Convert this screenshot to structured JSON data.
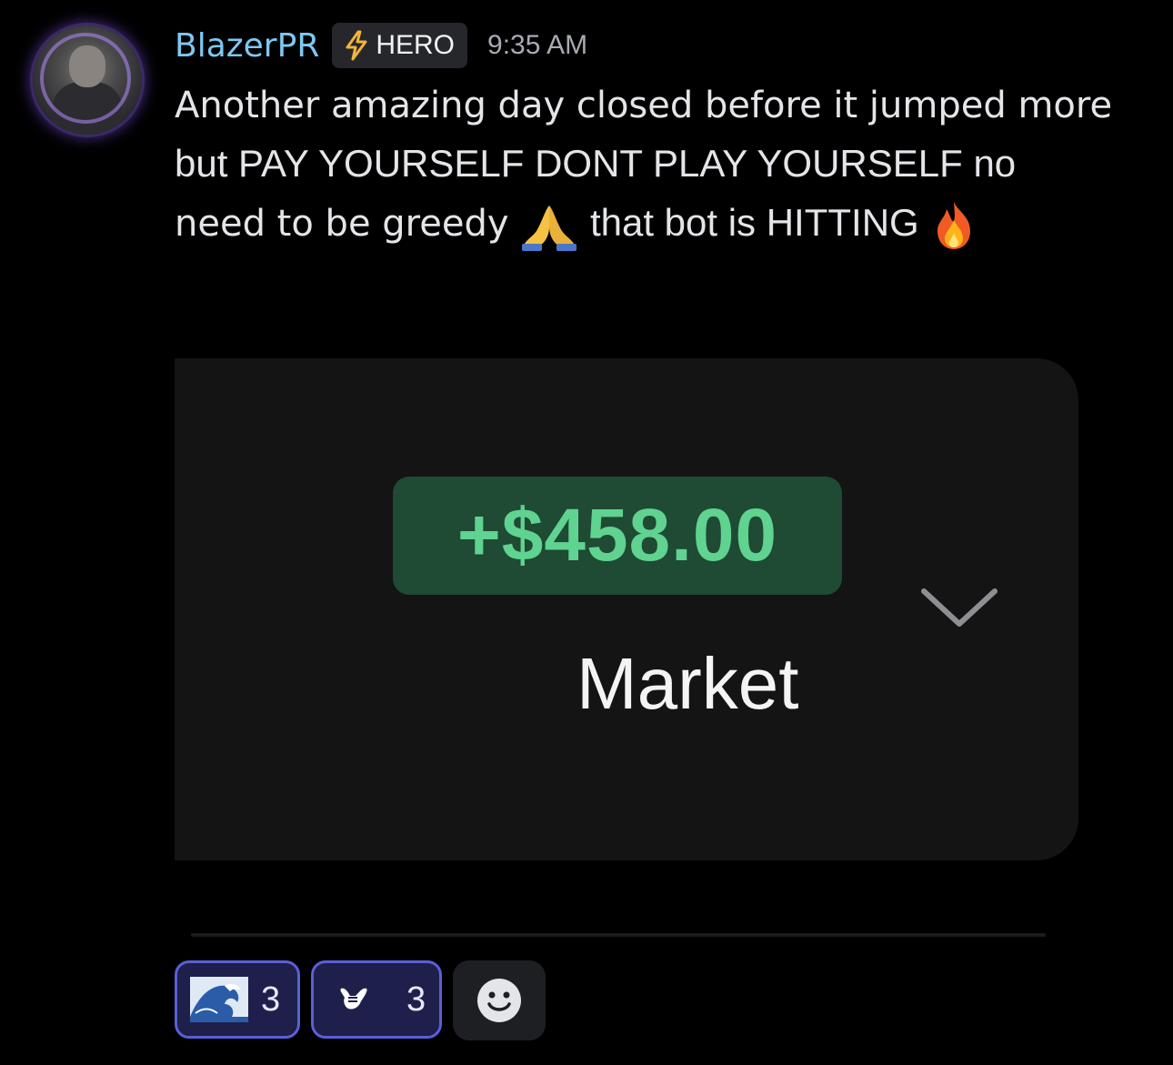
{
  "author": {
    "username": "BlazerPR",
    "badge": {
      "icon": "lightning-bolt-icon",
      "label": "HERO"
    },
    "timestamp": "9:35 AM"
  },
  "message": {
    "line1": "Another amazing day closed before it jumped more",
    "line2": "but PAY YOURSELF DONT PLAY YOURSELF no",
    "line3_a": "need to be greedy",
    "line3_b": "that bot is HITTING",
    "emojis": [
      "folded-hands-emoji",
      "fire-emoji"
    ]
  },
  "attachment": {
    "pnl": "+$458.00",
    "label": "Market",
    "icon": "chevron-down-icon"
  },
  "reactions": [
    {
      "emoji": "wave-emoji",
      "count": "3",
      "active": true
    },
    {
      "emoji": "shaka-hand-emoji",
      "count": "3",
      "active": true
    }
  ],
  "add_reaction": {
    "icon": "smiley-add-reaction-icon"
  },
  "colors": {
    "background": "#000000",
    "username": "#7ec8f0",
    "pnl_text": "#5fd38f",
    "pnl_bg": "#1f4a34",
    "reaction_border": "#5b5fd6"
  }
}
